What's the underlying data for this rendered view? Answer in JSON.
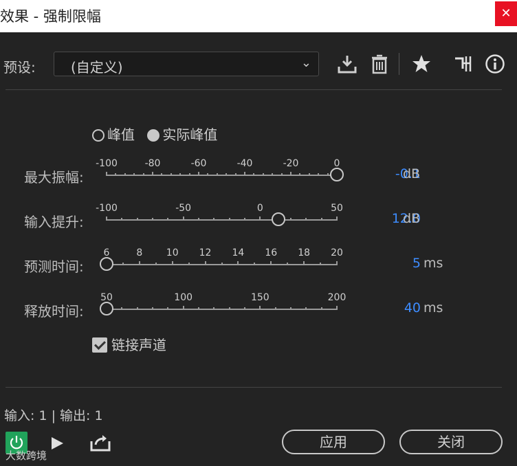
{
  "window": {
    "title": "效果 - 强制限幅",
    "close_symbol": "✕"
  },
  "preset": {
    "label": "预设:",
    "value": "(自定义)"
  },
  "toolbar_icons": [
    "save-preset-icon",
    "delete-icon",
    "favorite-star-icon",
    "routing-icon",
    "info-icon"
  ],
  "mode": {
    "options": [
      {
        "label": "峰值",
        "selected": false
      },
      {
        "label": "实际峰值",
        "selected": true
      }
    ]
  },
  "params": [
    {
      "key": "max_amplitude",
      "label": "最大振幅:",
      "ticks": [
        "-100",
        "-80",
        "-60",
        "-40",
        "-20",
        "0"
      ],
      "min": -100,
      "max": 0,
      "value": -0.1,
      "value_text": "-0.1",
      "unit": "dB"
    },
    {
      "key": "input_boost",
      "label": "输入提升:",
      "ticks": [
        "-100",
        "-50",
        "0",
        "50"
      ],
      "min": -100,
      "max": 50,
      "value": 12.0,
      "value_text": "12.0",
      "unit": "dB"
    },
    {
      "key": "lookahead",
      "label": "预测时间:",
      "ticks": [
        "6",
        "8",
        "10",
        "12",
        "14",
        "16",
        "18",
        "20"
      ],
      "min": 5,
      "max": 20,
      "value": 5,
      "value_text": "5",
      "unit": "ms"
    },
    {
      "key": "release",
      "label": "释放时间:",
      "ticks": [
        "50",
        "100",
        "150",
        "200"
      ],
      "min": 40,
      "max": 200,
      "value": 40,
      "value_text": "40",
      "unit": "ms"
    }
  ],
  "link_channels": {
    "label": "链接声道",
    "checked": true
  },
  "io_text": "输入: 1 | 输出: 1",
  "footer": {
    "apply_label": "应用",
    "close_label": "关闭",
    "watermark": "大数跨境"
  },
  "colors": {
    "accent": "#3d8cff",
    "power": "#21a35b",
    "close": "#e81123",
    "background": "#232323"
  }
}
